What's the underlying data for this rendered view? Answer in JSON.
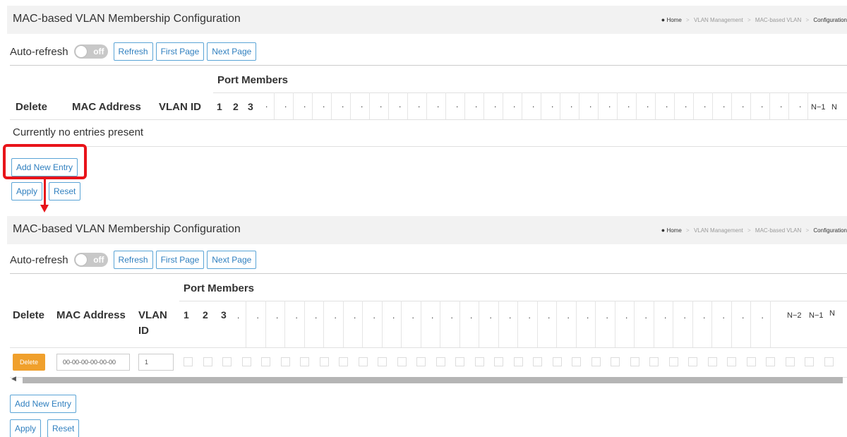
{
  "page": {
    "title": "MAC-based VLAN Membership Configuration",
    "breadcrumb": [
      "Home",
      "VLAN Management",
      "MAC-based VLAN",
      "Configuration"
    ]
  },
  "toolbar": {
    "auto_refresh_label": "Auto-refresh",
    "toggle_state": "off",
    "refresh": "Refresh",
    "first_page": "First Page",
    "next_page": "Next Page"
  },
  "table": {
    "group_header": "Port Members",
    "columns": [
      "Delete",
      "MAC Address",
      "VLAN ID"
    ],
    "col_vlan_a": "VLAN",
    "col_vlan_b": "ID",
    "ports": [
      "1",
      "2",
      "3"
    ],
    "n_minus_2": "N−2",
    "n_minus_1": "N−1",
    "n": "N",
    "empty_message": "Currently no entries present"
  },
  "entry": {
    "delete": "Delete",
    "mac_value": "00-00-00-00-00-00",
    "vlan_value": "1"
  },
  "actions": {
    "add_new_entry": "Add New Entry",
    "apply": "Apply",
    "reset": "Reset"
  },
  "colors": {
    "accent": "#2f7fbf",
    "delete_button": "#f0a02c",
    "annotation": "#e8141a"
  }
}
